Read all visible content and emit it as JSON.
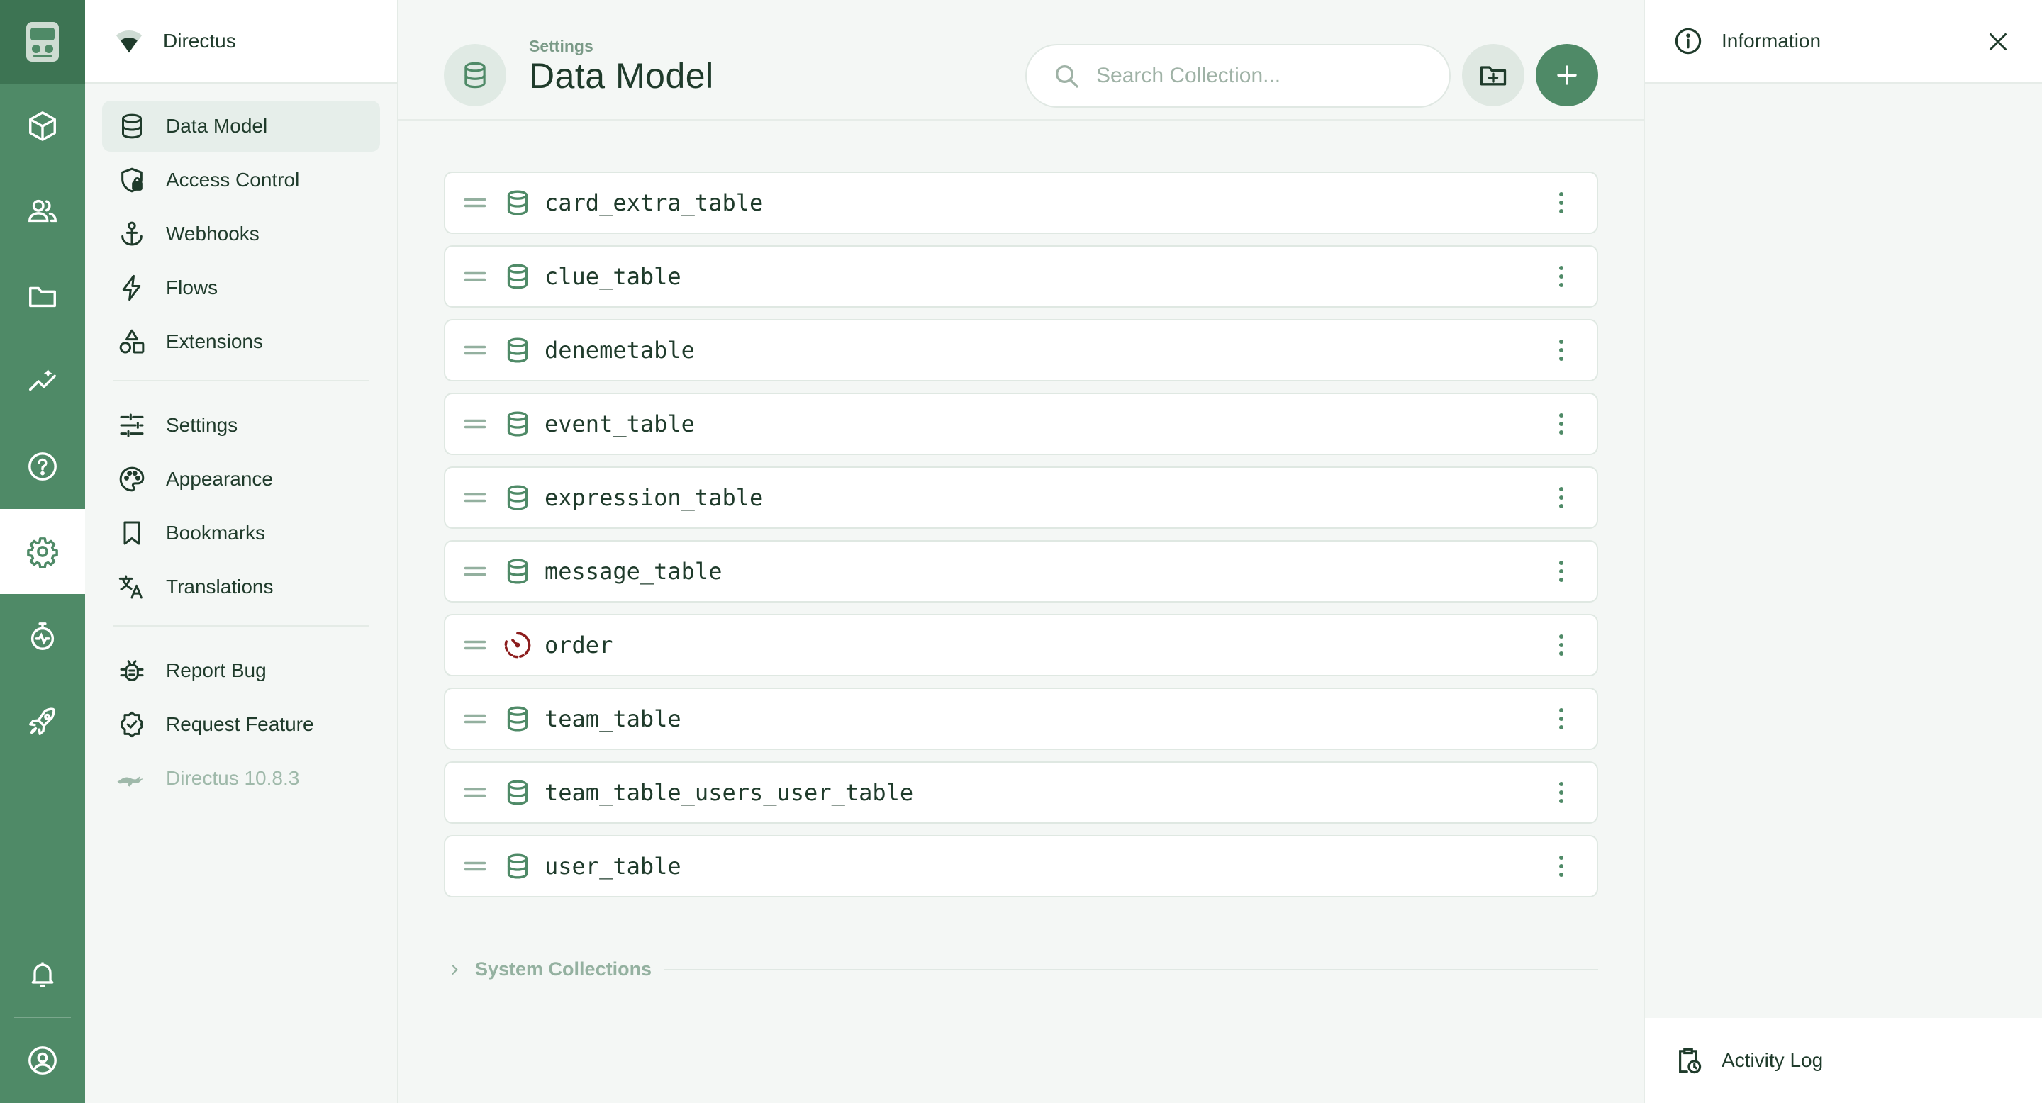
{
  "project": {
    "name": "Directus"
  },
  "modules": [
    {
      "id": "content",
      "icon": "cube-icon"
    },
    {
      "id": "users",
      "icon": "users-icon"
    },
    {
      "id": "files",
      "icon": "folder-icon"
    },
    {
      "id": "insights",
      "icon": "insights-icon"
    },
    {
      "id": "docs",
      "icon": "help-icon"
    },
    {
      "id": "settings",
      "icon": "gear-icon",
      "active": true
    },
    {
      "id": "monitor",
      "icon": "timer-icon"
    },
    {
      "id": "deploy",
      "icon": "rocket-icon"
    },
    {
      "id": "notifications",
      "icon": "bell-icon"
    },
    {
      "id": "account",
      "icon": "user-circle-icon"
    }
  ],
  "nav": {
    "groups": [
      [
        {
          "label": "Data Model",
          "icon": "database-icon",
          "active": true
        },
        {
          "label": "Access Control",
          "icon": "shield-lock-icon"
        },
        {
          "label": "Webhooks",
          "icon": "anchor-icon"
        },
        {
          "label": "Flows",
          "icon": "bolt-icon"
        },
        {
          "label": "Extensions",
          "icon": "shapes-icon"
        }
      ],
      [
        {
          "label": "Settings",
          "icon": "sliders-icon"
        },
        {
          "label": "Appearance",
          "icon": "palette-icon"
        },
        {
          "label": "Bookmarks",
          "icon": "bookmark-icon"
        },
        {
          "label": "Translations",
          "icon": "translate-icon"
        }
      ],
      [
        {
          "label": "Report Bug",
          "icon": "bug-icon"
        },
        {
          "label": "Request Feature",
          "icon": "badge-check-icon"
        }
      ]
    ],
    "version": "Directus 10.8.3"
  },
  "header": {
    "breadcrumb": "Settings",
    "title": "Data Model",
    "search_placeholder": "Search Collection..."
  },
  "collections": [
    {
      "name": "card_extra_table",
      "icon": "database-icon"
    },
    {
      "name": "clue_table",
      "icon": "database-icon"
    },
    {
      "name": "denemetable",
      "icon": "database-icon"
    },
    {
      "name": "event_table",
      "icon": "database-icon"
    },
    {
      "name": "expression_table",
      "icon": "database-icon"
    },
    {
      "name": "message_table",
      "icon": "database-icon"
    },
    {
      "name": "order",
      "icon": "timer-dashed-icon",
      "color": "#8c1d1d"
    },
    {
      "name": "team_table",
      "icon": "database-icon"
    },
    {
      "name": "team_table_users_user_table",
      "icon": "database-icon"
    },
    {
      "name": "user_table",
      "icon": "database-icon"
    }
  ],
  "system_collections_label": "System Collections",
  "sidebar": {
    "info_label": "Information",
    "activity_label": "Activity Log"
  },
  "colors": {
    "accent": "#4f8a67",
    "accent_dark": "#3d7453",
    "order_icon": "#8c1d1d"
  }
}
